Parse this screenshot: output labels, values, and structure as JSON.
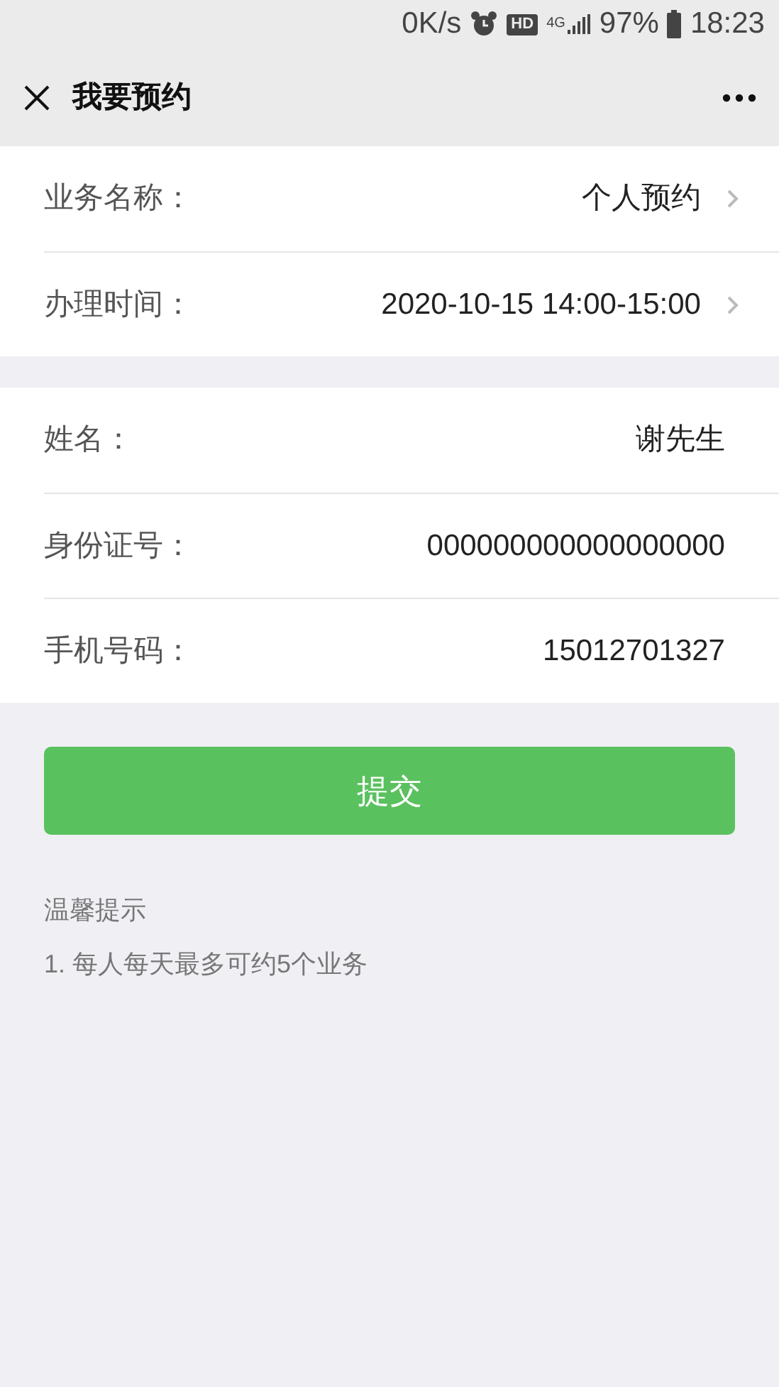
{
  "status_bar": {
    "speed": "0K/s",
    "hd": "HD",
    "network": "4G",
    "battery": "97%",
    "time": "18:23"
  },
  "header": {
    "title": "我要预约"
  },
  "sections": [
    {
      "rows": [
        {
          "label": "业务名称：",
          "value": "个人预约",
          "has_arrow": true
        },
        {
          "label": "办理时间：",
          "value": "2020-10-15 14:00-15:00",
          "has_arrow": true
        }
      ]
    },
    {
      "rows": [
        {
          "label": "姓名：",
          "value": "谢先生",
          "has_arrow": false
        },
        {
          "label": "身份证号：",
          "value": "000000000000000000",
          "has_arrow": false
        },
        {
          "label": "手机号码：",
          "value": "15012701327",
          "has_arrow": false
        }
      ]
    }
  ],
  "submit_button": "提交",
  "tips": {
    "title": "温馨提示",
    "items": [
      "1. 每人每天最多可约5个业务"
    ]
  }
}
